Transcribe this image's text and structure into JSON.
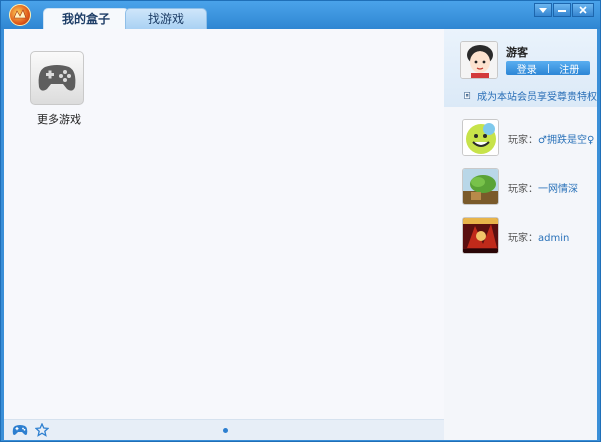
{
  "tabs": [
    {
      "label": "我的盒子",
      "active": true
    },
    {
      "label": "找游戏",
      "active": false
    }
  ],
  "main": {
    "games": [
      {
        "label": "更多游戏",
        "icon": "gamepad-icon"
      }
    ]
  },
  "profile": {
    "name": "游客",
    "login_label": "登录",
    "register_label": "注册",
    "vip_text": "成为本站会员享受尊贵特权"
  },
  "players": [
    {
      "prefix": "玩家：",
      "name": "♂拥跌是空♀",
      "avatar": "smiley-face-icon"
    },
    {
      "prefix": "玩家：",
      "name": "一网情深",
      "avatar": "tree-landscape-icon"
    },
    {
      "prefix": "玩家：",
      "name": "admin",
      "avatar": "red-dragon-icon"
    }
  ],
  "colors": {
    "titlebar": "#2f86d2",
    "accent": "#2a72b9",
    "tab_active_bg": "#f6f9fc"
  }
}
